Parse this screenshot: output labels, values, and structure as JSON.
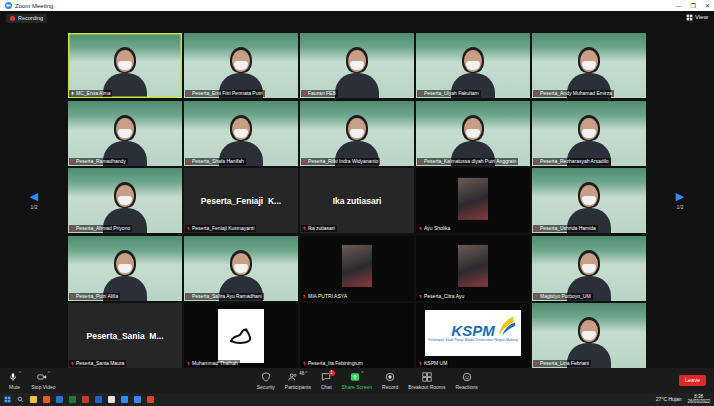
{
  "window": {
    "title": "Zoom Meeting",
    "controls": [
      "—",
      "❐",
      "✕"
    ]
  },
  "recording": {
    "label": "Recording",
    "on": true
  },
  "view": {
    "label": "View"
  },
  "pager": {
    "prev": "◀",
    "next": "▶",
    "left_page": "1/2",
    "right_page": "1/2"
  },
  "tiles": [
    {
      "name": "MC_Ervia Alma",
      "kind": "video",
      "muted": false,
      "speaking": true
    },
    {
      "name": "Peserta_Erni Fitri Permata Putri",
      "kind": "video",
      "muted": true,
      "speaking": false
    },
    {
      "name": "Fauzan FEB",
      "kind": "video",
      "muted": true,
      "speaking": false
    },
    {
      "name": "Peserta_Ulyah Fakultam",
      "kind": "video",
      "muted": true,
      "speaking": false
    },
    {
      "name": "Peserta_Andy Muhamad Emirza",
      "kind": "video",
      "muted": true,
      "speaking": false
    },
    {
      "name": "Peserta_Ramadhandy",
      "kind": "video",
      "muted": true,
      "speaking": false
    },
    {
      "name": "Peserta_Shafa Hanifah",
      "kind": "video",
      "muted": true,
      "speaking": false
    },
    {
      "name": "Peserta_Rifki Indra Widyananto",
      "kind": "video",
      "muted": true,
      "speaking": false
    },
    {
      "name": "Peserta_Kalmatussa diyah Putri Anggrain",
      "kind": "video",
      "muted": true,
      "speaking": false
    },
    {
      "name": "Peserta_Rezharasyah Arsadilo",
      "kind": "video",
      "muted": true,
      "speaking": false
    },
    {
      "name": "Peserta_Ahmad Priyono",
      "kind": "video",
      "muted": true,
      "speaking": false
    },
    {
      "name": "Peserta_Feniaji Kusmayanti",
      "kind": "name",
      "display": "Peserta_Feniaji  K...",
      "muted": true,
      "speaking": false
    },
    {
      "name": "Ika zutiasari",
      "kind": "name",
      "display": "Ika zutiasari",
      "muted": true,
      "speaking": false
    },
    {
      "name": "Ayu Sholika",
      "kind": "avatar",
      "muted": true,
      "speaking": false
    },
    {
      "name": "Peserta_Ushrida Hamida",
      "kind": "video",
      "muted": true,
      "speaking": false
    },
    {
      "name": "Peserta_Putri Alifia",
      "kind": "video",
      "muted": true,
      "speaking": false
    },
    {
      "name": "Peserta_Safira Ayu Ramadhani",
      "kind": "video",
      "muted": true,
      "speaking": false
    },
    {
      "name": "MIA PUTRI ASYA",
      "kind": "avatar",
      "muted": true,
      "speaking": false
    },
    {
      "name": "Peserta_Citra Ayu",
      "kind": "avatar",
      "muted": true,
      "speaking": false
    },
    {
      "name": "Magistyo Purboyo_UM",
      "kind": "video",
      "muted": true,
      "speaking": false
    },
    {
      "name": "Peserta_Sania Maura",
      "kind": "name",
      "display": "Peserta_Sania  M...",
      "muted": true,
      "speaking": false
    },
    {
      "name": "Muhammad Thalhah",
      "kind": "image",
      "muted": true,
      "speaking": false
    },
    {
      "name": "Peserta_Ira Febiningrum",
      "kind": "blank",
      "muted": true,
      "speaking": false
    },
    {
      "name": "KSPM UM",
      "kind": "logo",
      "logo_title": "KSPM",
      "logo_subtitle": "Kelompok Studi Pasar Modal Universitas Negeri Malang",
      "muted": true,
      "speaking": false
    },
    {
      "name": "Peserta_Lina Febriani",
      "kind": "video",
      "muted": true,
      "speaking": false
    }
  ],
  "toolbar": {
    "items": [
      {
        "label": "Mute",
        "menu": "^",
        "highlighted": false
      },
      {
        "label": "Stop Video",
        "menu": "^",
        "highlighted": false
      },
      {
        "label": "Security",
        "highlighted": false
      },
      {
        "label": "Participants",
        "count": "48",
        "menu": "^",
        "highlighted": false
      },
      {
        "label": "Chat",
        "badge": "1",
        "highlighted": false
      },
      {
        "label": "Share Screen",
        "menu": "^",
        "highlighted": true
      },
      {
        "label": "Record",
        "highlighted": false
      },
      {
        "label": "Breakout Rooms",
        "highlighted": false
      },
      {
        "label": "Reactions",
        "highlighted": false
      }
    ],
    "leave": "Leave"
  },
  "taskbar": {
    "weather": "27°C Hujan",
    "time": "8:38",
    "date": "26/03/2022"
  }
}
